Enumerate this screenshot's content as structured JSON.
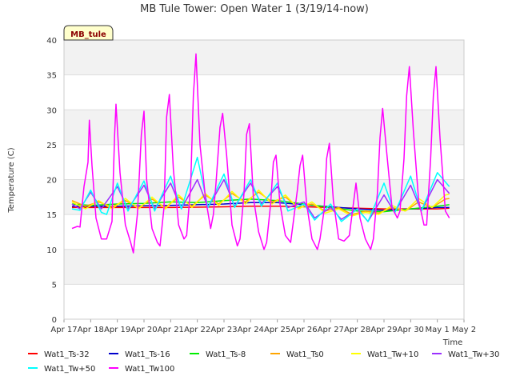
{
  "chart_data": {
    "type": "line",
    "title": "MB Tule Tower: Open Water 1 (3/19/14-now)",
    "xlabel": "Time",
    "ylabel": "Temperature (C)",
    "site_tag": "MB_tule",
    "ylim": [
      0,
      40
    ],
    "yticks": [
      0,
      5,
      10,
      15,
      20,
      25,
      30,
      35,
      40
    ],
    "xlim": [
      0,
      15
    ],
    "xticks": [
      {
        "x": 0,
        "label": "Apr 17"
      },
      {
        "x": 1,
        "label": "Apr 18"
      },
      {
        "x": 2,
        "label": "Apr 19"
      },
      {
        "x": 3,
        "label": "Apr 20"
      },
      {
        "x": 4,
        "label": "Apr 21"
      },
      {
        "x": 5,
        "label": "Apr 22"
      },
      {
        "x": 6,
        "label": "Apr 23"
      },
      {
        "x": 7,
        "label": "Apr 24"
      },
      {
        "x": 8,
        "label": "Apr 25"
      },
      {
        "x": 9,
        "label": "Apr 26"
      },
      {
        "x": 10,
        "label": "Apr 27"
      },
      {
        "x": 11,
        "label": "Apr 28"
      },
      {
        "x": 12,
        "label": "Apr 29"
      },
      {
        "x": 13,
        "label": "Apr 30"
      },
      {
        "x": 14,
        "label": "May 1"
      },
      {
        "x": 15,
        "label": "May 2"
      }
    ],
    "grid": true,
    "legend_position": "bottom",
    "series": [
      {
        "name": "Wat1_Ts-32",
        "color": "#ff0000",
        "points": [
          [
            0.3,
            16.0
          ],
          [
            2,
            16.0
          ],
          [
            4,
            16.0
          ],
          [
            6,
            16.1
          ],
          [
            7,
            16.2
          ],
          [
            8,
            16.2
          ],
          [
            9,
            16.1
          ],
          [
            10,
            16.0
          ],
          [
            11,
            15.9
          ],
          [
            12,
            15.8
          ],
          [
            13,
            15.8
          ],
          [
            14,
            15.8
          ],
          [
            14.45,
            15.9
          ]
        ]
      },
      {
        "name": "Wat1_Ts-16",
        "color": "#0000cc",
        "points": [
          [
            0.3,
            16.2
          ],
          [
            2,
            16.2
          ],
          [
            4,
            16.3
          ],
          [
            6,
            16.5
          ],
          [
            7,
            16.7
          ],
          [
            8,
            16.7
          ],
          [
            9,
            16.4
          ],
          [
            10,
            16.1
          ],
          [
            11,
            15.8
          ],
          [
            12,
            15.6
          ],
          [
            13,
            15.8
          ],
          [
            14,
            16.0
          ],
          [
            14.45,
            16.0
          ]
        ]
      },
      {
        "name": "Wat1_Ts-8",
        "color": "#00ee00",
        "points": [
          [
            0.3,
            16.5
          ],
          [
            1,
            16.3
          ],
          [
            2,
            16.5
          ],
          [
            3,
            16.6
          ],
          [
            4,
            16.8
          ],
          [
            5,
            16.7
          ],
          [
            6,
            17.0
          ],
          [
            7,
            17.2
          ],
          [
            8,
            17.0
          ],
          [
            9,
            16.5
          ],
          [
            10,
            16.0
          ],
          [
            11,
            15.5
          ],
          [
            12,
            15.4
          ],
          [
            13,
            15.8
          ],
          [
            14,
            16.2
          ],
          [
            14.45,
            16.4
          ]
        ]
      },
      {
        "name": "Wat1_Ts0",
        "color": "#ffa500",
        "points": [
          [
            0.3,
            17.0
          ],
          [
            0.8,
            16.2
          ],
          [
            1.3,
            16.8
          ],
          [
            1.8,
            16.1
          ],
          [
            2.3,
            17.0
          ],
          [
            2.8,
            16.0
          ],
          [
            3.3,
            17.2
          ],
          [
            3.8,
            16.0
          ],
          [
            4.3,
            17.5
          ],
          [
            4.8,
            16.2
          ],
          [
            5.3,
            17.8
          ],
          [
            5.8,
            16.5
          ],
          [
            6.3,
            18.0
          ],
          [
            6.8,
            16.8
          ],
          [
            7.3,
            18.2
          ],
          [
            7.8,
            16.8
          ],
          [
            8.3,
            17.5
          ],
          [
            8.8,
            16.0
          ],
          [
            9.3,
            16.5
          ],
          [
            9.8,
            15.5
          ],
          [
            10.3,
            16.0
          ],
          [
            10.8,
            15.0
          ],
          [
            11.3,
            15.5
          ],
          [
            11.8,
            15.2
          ],
          [
            12.3,
            16.0
          ],
          [
            12.8,
            15.5
          ],
          [
            13.3,
            16.8
          ],
          [
            13.8,
            16.0
          ],
          [
            14.3,
            17.2
          ],
          [
            14.45,
            17.3
          ]
        ]
      },
      {
        "name": "Wat1_Tw+10",
        "color": "#ffff00",
        "points": [
          [
            0.3,
            16.8
          ],
          [
            0.8,
            15.8
          ],
          [
            1.3,
            17.0
          ],
          [
            1.8,
            15.8
          ],
          [
            2.3,
            17.3
          ],
          [
            2.8,
            15.8
          ],
          [
            3.3,
            17.5
          ],
          [
            3.8,
            15.8
          ],
          [
            4.3,
            17.8
          ],
          [
            4.8,
            16.0
          ],
          [
            5.3,
            18.0
          ],
          [
            5.8,
            16.3
          ],
          [
            6.3,
            18.3
          ],
          [
            6.8,
            16.5
          ],
          [
            7.3,
            18.5
          ],
          [
            7.8,
            16.5
          ],
          [
            8.3,
            17.8
          ],
          [
            8.8,
            15.8
          ],
          [
            9.3,
            16.8
          ],
          [
            9.8,
            15.2
          ],
          [
            10.3,
            15.8
          ],
          [
            10.8,
            14.8
          ],
          [
            11.3,
            15.3
          ],
          [
            11.8,
            15.0
          ],
          [
            12.3,
            16.3
          ],
          [
            12.8,
            15.5
          ],
          [
            13.3,
            17.3
          ],
          [
            13.8,
            16.0
          ],
          [
            14.3,
            17.8
          ],
          [
            14.45,
            17.9
          ]
        ]
      },
      {
        "name": "Wat1_Tw+30",
        "color": "#9b30ff",
        "points": [
          [
            0.3,
            16.5
          ],
          [
            0.6,
            15.8
          ],
          [
            1.0,
            18.2
          ],
          [
            1.4,
            15.8
          ],
          [
            2.0,
            19.0
          ],
          [
            2.4,
            15.8
          ],
          [
            3.0,
            19.2
          ],
          [
            3.4,
            15.8
          ],
          [
            4.0,
            19.5
          ],
          [
            4.4,
            15.8
          ],
          [
            5.0,
            20.0
          ],
          [
            5.4,
            16.0
          ],
          [
            6.0,
            20.0
          ],
          [
            6.4,
            16.2
          ],
          [
            7.0,
            19.5
          ],
          [
            7.4,
            16.5
          ],
          [
            8.0,
            19.0
          ],
          [
            8.4,
            16.0
          ],
          [
            9.0,
            16.8
          ],
          [
            9.4,
            14.5
          ],
          [
            10.0,
            16.0
          ],
          [
            10.4,
            14.3
          ],
          [
            11.0,
            15.8
          ],
          [
            11.4,
            14.0
          ],
          [
            12.0,
            17.8
          ],
          [
            12.4,
            15.3
          ],
          [
            13.0,
            19.2
          ],
          [
            13.4,
            15.5
          ],
          [
            14.0,
            20.0
          ],
          [
            14.45,
            18.0
          ]
        ]
      },
      {
        "name": "Wat1_Tw+50",
        "color": "#00ffff",
        "points": [
          [
            0.3,
            15.8
          ],
          [
            0.6,
            15.6
          ],
          [
            1.0,
            18.5
          ],
          [
            1.4,
            15.3
          ],
          [
            1.6,
            15.0
          ],
          [
            2.0,
            19.5
          ],
          [
            2.4,
            15.5
          ],
          [
            3.0,
            19.8
          ],
          [
            3.4,
            15.5
          ],
          [
            4.0,
            20.5
          ],
          [
            4.4,
            15.8
          ],
          [
            5.0,
            23.2
          ],
          [
            5.4,
            16.0
          ],
          [
            6.0,
            20.8
          ],
          [
            6.4,
            16.0
          ],
          [
            7.0,
            20.0
          ],
          [
            7.4,
            16.2
          ],
          [
            8.0,
            19.5
          ],
          [
            8.4,
            15.5
          ],
          [
            9.0,
            16.5
          ],
          [
            9.4,
            14.2
          ],
          [
            10.0,
            16.5
          ],
          [
            10.4,
            14.0
          ],
          [
            11.0,
            15.8
          ],
          [
            11.4,
            14.0
          ],
          [
            12.0,
            19.5
          ],
          [
            12.4,
            15.2
          ],
          [
            13.0,
            20.5
          ],
          [
            13.4,
            15.5
          ],
          [
            14.0,
            21.0
          ],
          [
            14.45,
            19.0
          ]
        ]
      },
      {
        "name": "Wat1_Tw100",
        "color": "#ff00ff",
        "points": [
          [
            0.3,
            13.0
          ],
          [
            0.5,
            13.3
          ],
          [
            0.6,
            13.2
          ],
          [
            0.75,
            19.0
          ],
          [
            0.9,
            22.5
          ],
          [
            0.95,
            28.5
          ],
          [
            1.05,
            22.0
          ],
          [
            1.2,
            14.5
          ],
          [
            1.4,
            11.5
          ],
          [
            1.6,
            11.5
          ],
          [
            1.8,
            14.0
          ],
          [
            1.9,
            26.5
          ],
          [
            1.95,
            30.8
          ],
          [
            2.1,
            21.0
          ],
          [
            2.3,
            13.5
          ],
          [
            2.5,
            11.0
          ],
          [
            2.6,
            9.5
          ],
          [
            2.75,
            15.0
          ],
          [
            2.9,
            26.5
          ],
          [
            3.0,
            29.8
          ],
          [
            3.1,
            20.0
          ],
          [
            3.3,
            13.0
          ],
          [
            3.5,
            11.0
          ],
          [
            3.6,
            10.5
          ],
          [
            3.75,
            16.0
          ],
          [
            3.85,
            29.0
          ],
          [
            3.95,
            32.2
          ],
          [
            4.1,
            21.5
          ],
          [
            4.3,
            13.5
          ],
          [
            4.5,
            11.5
          ],
          [
            4.6,
            12.0
          ],
          [
            4.75,
            19.0
          ],
          [
            4.85,
            32.0
          ],
          [
            4.95,
            38.0
          ],
          [
            5.1,
            25.0
          ],
          [
            5.3,
            17.5
          ],
          [
            5.5,
            13.0
          ],
          [
            5.6,
            15.0
          ],
          [
            5.7,
            19.5
          ],
          [
            5.85,
            27.5
          ],
          [
            5.95,
            29.5
          ],
          [
            6.1,
            23.5
          ],
          [
            6.3,
            13.5
          ],
          [
            6.5,
            10.5
          ],
          [
            6.6,
            11.5
          ],
          [
            6.75,
            18.0
          ],
          [
            6.85,
            26.5
          ],
          [
            6.95,
            28.0
          ],
          [
            7.1,
            17.5
          ],
          [
            7.3,
            12.5
          ],
          [
            7.5,
            10.0
          ],
          [
            7.6,
            11.0
          ],
          [
            7.75,
            16.5
          ],
          [
            7.85,
            22.5
          ],
          [
            7.95,
            23.5
          ],
          [
            8.1,
            16.5
          ],
          [
            8.3,
            12.0
          ],
          [
            8.5,
            11.0
          ],
          [
            8.6,
            14.0
          ],
          [
            8.75,
            18.5
          ],
          [
            8.85,
            22.0
          ],
          [
            8.95,
            23.5
          ],
          [
            9.1,
            16.5
          ],
          [
            9.3,
            11.5
          ],
          [
            9.5,
            10.0
          ],
          [
            9.6,
            11.5
          ],
          [
            9.75,
            15.5
          ],
          [
            9.85,
            23.0
          ],
          [
            9.95,
            25.2
          ],
          [
            10.1,
            17.0
          ],
          [
            10.3,
            11.5
          ],
          [
            10.5,
            11.2
          ],
          [
            10.7,
            12.0
          ],
          [
            10.85,
            16.5
          ],
          [
            10.95,
            19.5
          ],
          [
            11.1,
            14.5
          ],
          [
            11.3,
            11.5
          ],
          [
            11.5,
            10.0
          ],
          [
            11.6,
            11.5
          ],
          [
            11.75,
            18.0
          ],
          [
            11.85,
            26.0
          ],
          [
            11.95,
            30.2
          ],
          [
            12.1,
            24.0
          ],
          [
            12.3,
            16.0
          ],
          [
            12.5,
            14.5
          ],
          [
            12.6,
            15.5
          ],
          [
            12.75,
            23.0
          ],
          [
            12.85,
            32.0
          ],
          [
            12.95,
            36.2
          ],
          [
            13.1,
            27.0
          ],
          [
            13.3,
            17.0
          ],
          [
            13.5,
            13.5
          ],
          [
            13.6,
            13.5
          ],
          [
            13.75,
            23.0
          ],
          [
            13.85,
            32.0
          ],
          [
            13.95,
            36.2
          ],
          [
            14.1,
            26.0
          ],
          [
            14.3,
            15.5
          ],
          [
            14.45,
            14.5
          ]
        ]
      }
    ]
  }
}
